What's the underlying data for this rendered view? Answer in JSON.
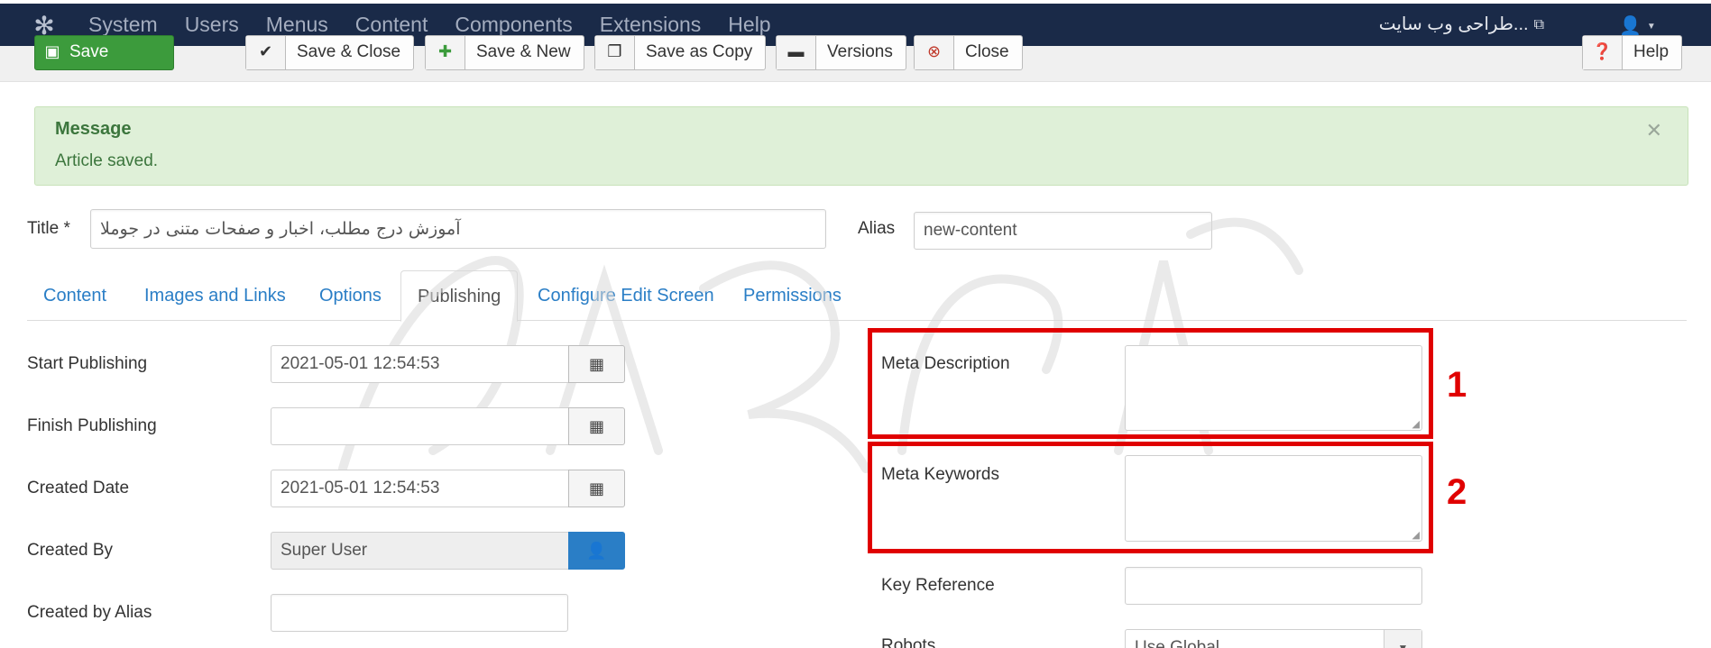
{
  "nav": {
    "items": [
      "System",
      "Users",
      "Menus",
      "Content",
      "Components",
      "Extensions",
      "Help"
    ],
    "site_link": "...طراحی وب سایت"
  },
  "toolbar": {
    "save": "Save",
    "save_close": "Save & Close",
    "save_new": "Save & New",
    "save_copy": "Save as Copy",
    "versions": "Versions",
    "close": "Close",
    "help": "Help"
  },
  "message": {
    "heading": "Message",
    "text": "Article saved."
  },
  "article": {
    "title_label": "Title *",
    "title_value": "آموزش درج مطلب، اخبار و صفحات متنی در جوملا",
    "alias_label": "Alias",
    "alias_value": "new-content"
  },
  "tabs": [
    "Content",
    "Images and Links",
    "Options",
    "Publishing",
    "Configure Edit Screen",
    "Permissions"
  ],
  "active_tab": "Publishing",
  "publishing": {
    "start_label": "Start Publishing",
    "start_value": "2021-05-01 12:54:53",
    "finish_label": "Finish Publishing",
    "finish_value": "",
    "created_label": "Created Date",
    "created_value": "2021-05-01 12:54:53",
    "created_by_label": "Created By",
    "created_by_value": "Super User",
    "created_alias_label": "Created by Alias",
    "created_alias_value": ""
  },
  "metadata": {
    "description_label": "Meta Description",
    "keywords_label": "Meta Keywords",
    "key_reference_label": "Key Reference",
    "robots_label": "Robots",
    "robots_value": "Use Global"
  },
  "annotations": {
    "box1": "1",
    "box2": "2",
    "color": "#e00000"
  }
}
